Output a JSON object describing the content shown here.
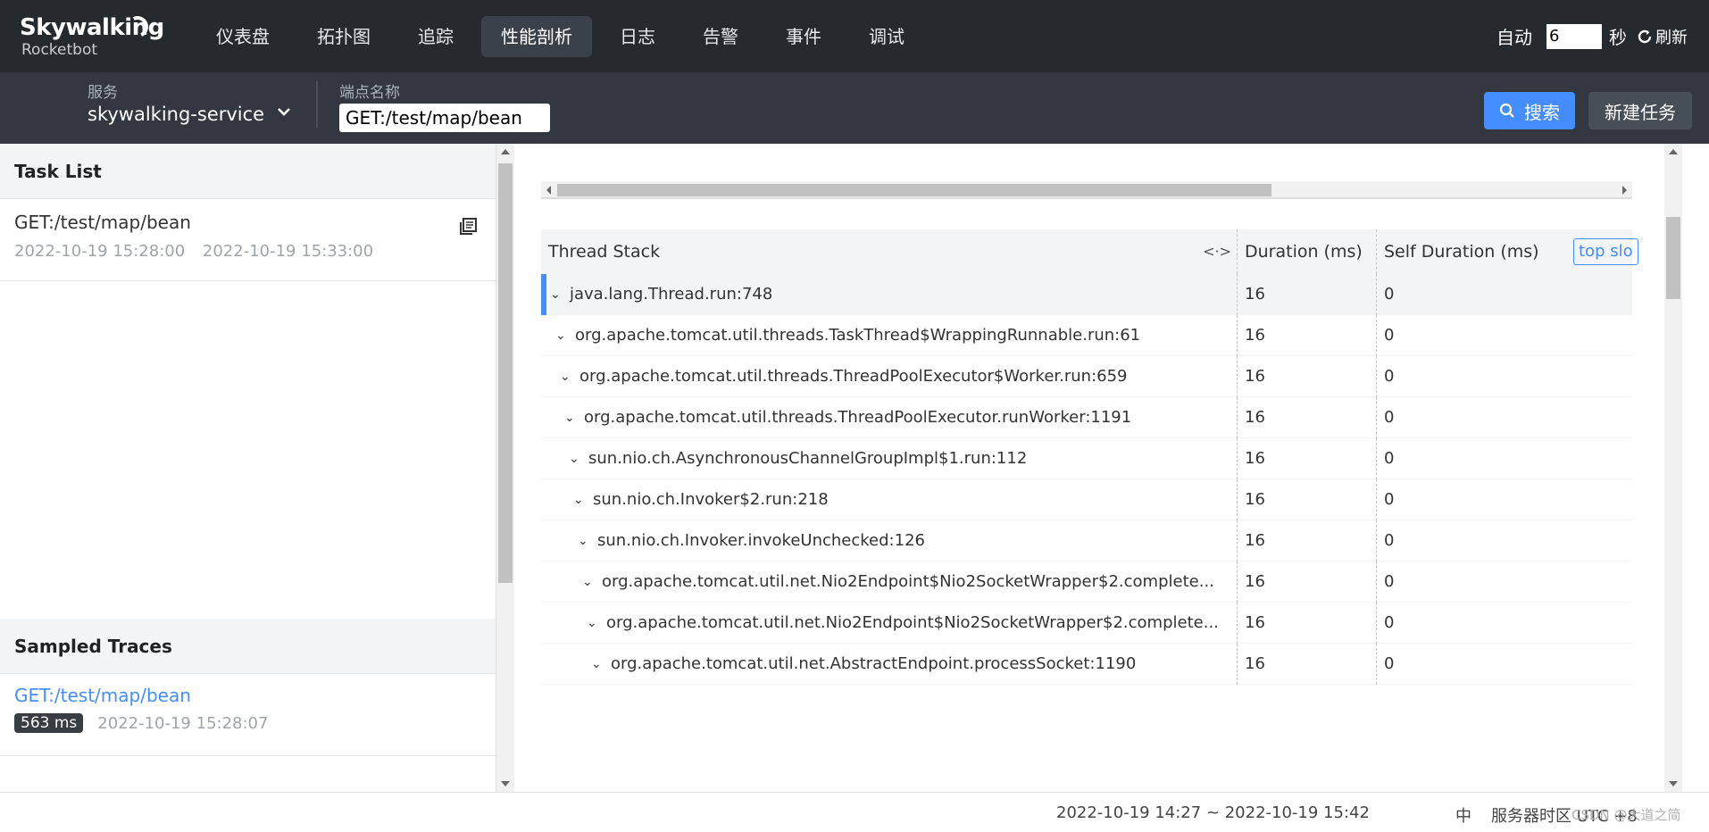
{
  "header": {
    "brand": "Skywalking",
    "subbrand": "Rocketbot",
    "nav": [
      {
        "label": "仪表盘",
        "active": false
      },
      {
        "label": "拓扑图",
        "active": false
      },
      {
        "label": "追踪",
        "active": false
      },
      {
        "label": "性能剖析",
        "active": true
      },
      {
        "label": "日志",
        "active": false
      },
      {
        "label": "告警",
        "active": false
      },
      {
        "label": "事件",
        "active": false
      },
      {
        "label": "调试",
        "active": false
      }
    ],
    "auto_label": "自动",
    "interval_value": "6",
    "seconds_label": "秒",
    "refresh_label": "刷新"
  },
  "toolbar": {
    "service_label": "服务",
    "service_value": "skywalking-service",
    "endpoint_label": "端点名称",
    "endpoint_value": "GET:/test/map/bean",
    "search_label": "搜索",
    "new_task_label": "新建任务"
  },
  "task_list": {
    "title": "Task List",
    "items": [
      {
        "name": "GET:/test/map/bean",
        "start": "2022-10-19 15:28:00",
        "end": "2022-10-19 15:33:00"
      }
    ]
  },
  "sampled_traces": {
    "title": "Sampled Traces",
    "items": [
      {
        "name": "GET:/test/map/bean",
        "duration": "563 ms",
        "time": "2022-10-19 15:28:07"
      }
    ]
  },
  "table": {
    "col_stack": "Thread Stack",
    "col_duration": "Duration (ms)",
    "col_self": "Self Duration (ms)",
    "top_slow_label": "top slo",
    "rows": [
      {
        "stack": "java.lang.Thread.run:748",
        "duration": "16",
        "self": "0"
      },
      {
        "stack": "org.apache.tomcat.util.threads.TaskThread$WrappingRunnable.run:61",
        "duration": "16",
        "self": "0"
      },
      {
        "stack": "org.apache.tomcat.util.threads.ThreadPoolExecutor$Worker.run:659",
        "duration": "16",
        "self": "0"
      },
      {
        "stack": "org.apache.tomcat.util.threads.ThreadPoolExecutor.runWorker:1191",
        "duration": "16",
        "self": "0"
      },
      {
        "stack": "sun.nio.ch.AsynchronousChannelGroupImpl$1.run:112",
        "duration": "16",
        "self": "0"
      },
      {
        "stack": "sun.nio.ch.Invoker$2.run:218",
        "duration": "16",
        "self": "0"
      },
      {
        "stack": "sun.nio.ch.Invoker.invokeUnchecked:126",
        "duration": "16",
        "self": "0"
      },
      {
        "stack": "org.apache.tomcat.util.net.Nio2Endpoint$Nio2SocketWrapper$2.complete...",
        "duration": "16",
        "self": "0"
      },
      {
        "stack": "org.apache.tomcat.util.net.Nio2Endpoint$Nio2SocketWrapper$2.complete...",
        "duration": "16",
        "self": "0"
      },
      {
        "stack": "org.apache.tomcat.util.net.AbstractEndpoint.processSocket:1190",
        "duration": "16",
        "self": "0"
      }
    ]
  },
  "footer": {
    "time_range": "2022-10-19 14:27 ~ 2022-10-19 15:42",
    "lang": "中",
    "timezone": "服务器时区 UTC +8",
    "watermark": "CSDN @大道之简"
  },
  "colors": {
    "accent": "#448dfe",
    "topbar": "#252a2f",
    "toolbar": "#333840"
  }
}
